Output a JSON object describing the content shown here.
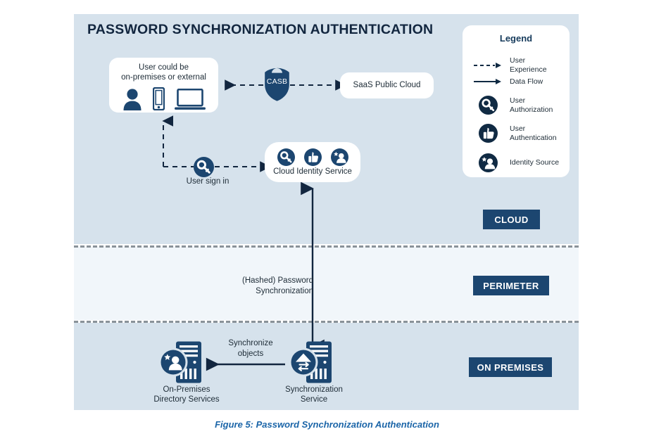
{
  "diagram": {
    "title": "PASSWORD SYNCHRONIZATION AUTHENTICATION",
    "caption": "Figure 5: Password Synchronization Authentication",
    "colors": {
      "band_cloud": "#d6e2ec",
      "band_perimeter": "#f1f6fa",
      "band_onprem": "#d6e2ec",
      "navy": "#1c4670",
      "dark_navy": "#102a43",
      "title": "#12263f",
      "caption": "#1b65a8",
      "divider": "#8a9299"
    }
  },
  "nodes": {
    "user_box": {
      "caption_line1": "User could be",
      "caption_line2": "on-premises or external",
      "icons": [
        "user-icon",
        "mobile-phone-icon",
        "laptop-icon"
      ]
    },
    "casb": {
      "label": "CASB",
      "icon": "shield-icon"
    },
    "saas": {
      "label": "SaaS Public Cloud"
    },
    "cloud_identity_service": {
      "label": "Cloud Identity Service",
      "icons": [
        "user-authorization-key-icon",
        "user-authentication-thumbsup-icon",
        "identity-source-icon"
      ]
    },
    "user_sign_in": {
      "label": "User sign in",
      "icon": "user-authorization-key-icon"
    },
    "directory_services": {
      "label_line1": "On-Premises",
      "label_line2": "Directory Services",
      "icon": "server-identity-source-icon"
    },
    "sync_service": {
      "label_line1": "Synchronization",
      "label_line2": "Service",
      "icon": "server-sync-icon"
    }
  },
  "edge_labels": {
    "synchronize_objects_line1": "Synchronize",
    "synchronize_objects_line2": "objects",
    "password_sync_line1": "(Hashed) Password",
    "password_sync_line2": "Synchronization"
  },
  "zones": [
    {
      "id": "cloud",
      "label": "CLOUD"
    },
    {
      "id": "perimeter",
      "label": "PERIMETER"
    },
    {
      "id": "onprem",
      "label": "ON PREMISES"
    }
  ],
  "legend": {
    "title": "Legend",
    "items": [
      {
        "icon": "dashed-arrow-icon",
        "label": "User Experience"
      },
      {
        "icon": "solid-arrow-icon",
        "label": "Data Flow"
      },
      {
        "icon": "user-authorization-key-icon",
        "label_line1": "User",
        "label_line2": "Authorization"
      },
      {
        "icon": "user-authentication-thumbsup-icon",
        "label_line1": "User",
        "label_line2": "Authentication"
      },
      {
        "icon": "identity-source-icon",
        "label": "Identity Source"
      }
    ]
  }
}
